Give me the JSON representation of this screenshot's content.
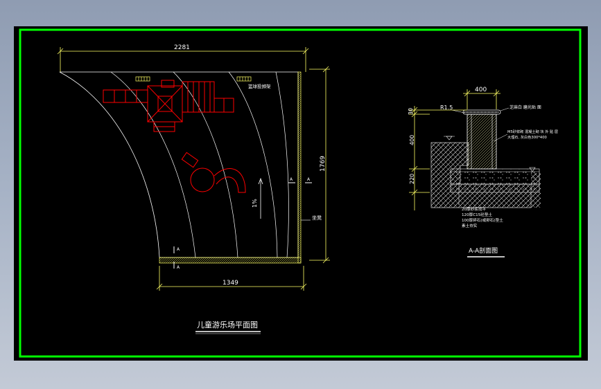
{
  "sheet": {
    "background": "#000000",
    "frame_color": "#00ff00",
    "line_color": "#ffff66",
    "object_color": "#ff0000"
  },
  "plan": {
    "dimensions": {
      "top_width": "2281",
      "bottom_width": "1349",
      "right_height": "1769"
    },
    "slope": "1%",
    "section_marker": "A",
    "notes": {
      "top_right_label": "篮球投掷架",
      "right_wall_label": "坐凳"
    },
    "title": "儿童游乐场平面图"
  },
  "section": {
    "dimensions": {
      "top_width": "400",
      "height_top": "30",
      "height_mid": "400",
      "height_bottom": "220"
    },
    "radius_label": "R1.5",
    "callouts": {
      "cap": "芝麻白 磨光贴 面",
      "wall_line1": "M5砂浆砌 混凝土砌 块 外 贴 层",
      "wall_line2": "大理石, 灰白色300*400",
      "layer1": "20厚砂浆找平",
      "layer2": "120厚C15砼垫土",
      "layer3": "100厚碎石(或卵石)垫土",
      "layer4": "素土夯实"
    },
    "title": "A-A剖面图"
  }
}
